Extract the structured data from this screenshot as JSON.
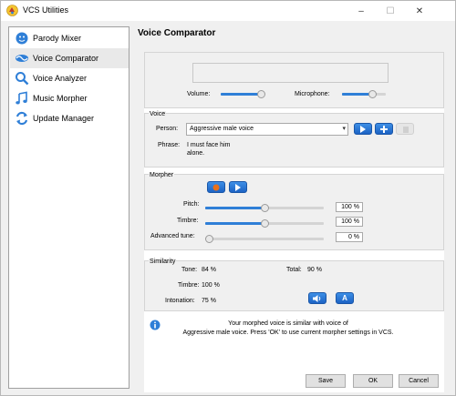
{
  "window": {
    "title": "VCS Utilities",
    "minimize": "–",
    "maximize": "☐",
    "close": "✕"
  },
  "sidebar": {
    "items": [
      {
        "label": "Parody Mixer",
        "icon": "parody-mixer-icon",
        "selected": false
      },
      {
        "label": "Voice Comparator",
        "icon": "voice-comparator-icon",
        "selected": true
      },
      {
        "label": "Voice Analyzer",
        "icon": "voice-analyzer-icon",
        "selected": false
      },
      {
        "label": "Music Morpher",
        "icon": "music-morpher-icon",
        "selected": false
      },
      {
        "label": "Update Manager",
        "icon": "update-manager-icon",
        "selected": false
      }
    ]
  },
  "main": {
    "title": "Voice Comparator",
    "levels": {
      "volume_label": "Volume:",
      "volume_value": 0.7,
      "microphone_label": "Microphone:",
      "microphone_value": 0.7
    },
    "voice": {
      "group_label": "Voice",
      "person_label": "Person:",
      "person_value": "Aggressive male voice",
      "phrase_label": "Phrase:",
      "phrase_line1": "I must face him",
      "phrase_line2": "alone."
    },
    "morpher": {
      "group_label": "Morpher",
      "pitch_label": "Pitch:",
      "pitch_value": "100 %",
      "pitch_level": 0.5,
      "timbre_label": "Timbre:",
      "timbre_value": "100 %",
      "timbre_level": 0.5,
      "advanced_label": "Advanced tune:",
      "advanced_value": "0 %",
      "advanced_level": 0.0
    },
    "similarity": {
      "group_label": "Similarity",
      "tone_label": "Tone:",
      "tone_value": "84 %",
      "total_label": "Total:",
      "total_value": "90 %",
      "timbre_label": "Timbre:",
      "timbre_value": "100 %",
      "intonation_label": "Intonation:",
      "intonation_value": "75 %",
      "a_button": "A"
    },
    "info": {
      "line1": "Your morphed voice is similar with voice of",
      "line2": "Aggressive male voice. Press 'OK' to use current morpher settings in VCS."
    }
  },
  "footer": {
    "save": "Save",
    "ok": "OK",
    "cancel": "Cancel"
  },
  "colors": {
    "accent": "#2f7fd7",
    "record": "#e8701a"
  }
}
